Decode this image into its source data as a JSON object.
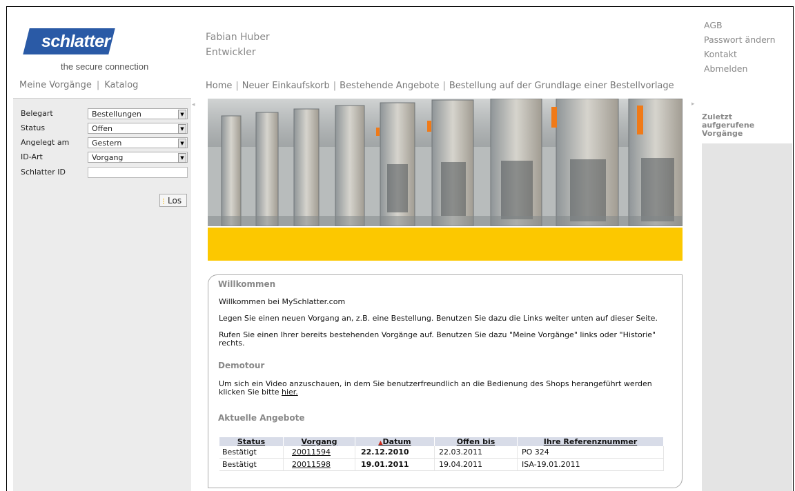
{
  "brand": {
    "logo_text": "schlatter",
    "tagline": "the secure connection",
    "logo_color": "#2a5aa6"
  },
  "user": {
    "name": "Fabian Huber",
    "role": "Entwickler"
  },
  "account_links": [
    "AGB",
    "Passwort ändern",
    "Kontakt",
    "Abmelden"
  ],
  "left_nav": [
    "Meine Vorgänge",
    "Katalog"
  ],
  "top_nav": [
    "Home",
    "Neuer Einkaufskorb",
    "Bestehende Angebote",
    "Bestellung auf der Grundlage einer Bestellvorlage"
  ],
  "search_form": {
    "belegart": {
      "label": "Belegart",
      "value": "Bestellungen"
    },
    "status": {
      "label": "Status",
      "value": "Offen"
    },
    "angelegt": {
      "label": "Angelegt am",
      "value": "Gestern"
    },
    "idart": {
      "label": "ID-Art",
      "value": "Vorgang"
    },
    "schlatter_id": {
      "label": "Schlatter ID",
      "value": ""
    },
    "submit_label": "Los"
  },
  "welcome": {
    "heading": "Willkommen",
    "line1": "Willkommen bei MySchlatter.com",
    "line2": "Legen Sie einen neuen Vorgang an, z.B. eine Bestellung. Benutzen Sie dazu die Links weiter unten auf dieser Seite.",
    "line3": "Rufen Sie einen Ihrer bereits bestehenden Vorgänge auf. Benutzen Sie dazu \"Meine Vorgänge\" links oder \"Historie\" rechts.",
    "demotour_heading": "Demotour",
    "demotour_text": "Um sich ein Video anzuschauen, in dem Sie benutzerfreundlich an die Bedienung des Shops herangeführt werden klicken Sie bitte",
    "demotour_link": "hier.",
    "offers_heading": "Aktuelle Angebote"
  },
  "offers_table": {
    "columns": [
      "Status",
      "Vorgang",
      "Datum",
      "Offen bis",
      "Ihre Referenznummer"
    ],
    "rows": [
      [
        "Bestätigt",
        "20011594",
        "22.12.2010",
        "22.03.2011",
        "PO 324"
      ],
      [
        "Bestätigt",
        "20011598",
        "19.01.2011",
        "19.04.2011",
        "ISA-19.01.2011"
      ]
    ]
  },
  "right_panel": {
    "title": "Zuletzt aufgerufene Vorgänge"
  },
  "colors": {
    "accent_yellow": "#fcc800",
    "table_header": "#d8dce8"
  }
}
